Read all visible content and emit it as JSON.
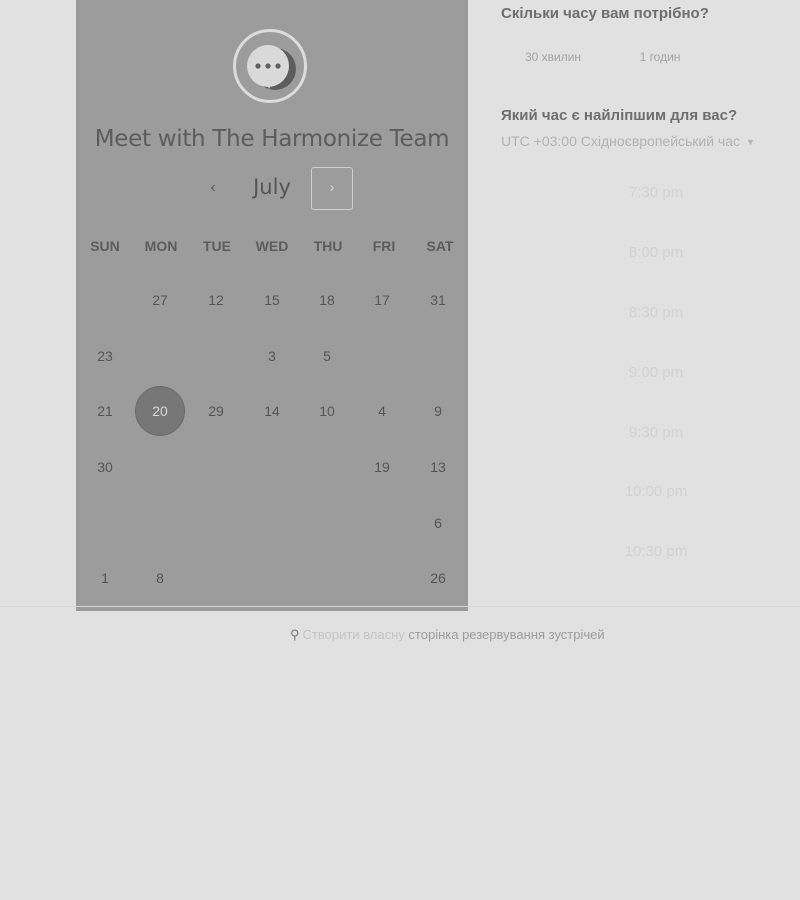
{
  "left_panel": {
    "title": "Meet with The Harmonize Team",
    "month": "July",
    "prev_glyph": "‹",
    "next_glyph": "›",
    "weekdays": [
      "SUN",
      "MON",
      "TUE",
      "WED",
      "THU",
      "FRI",
      "SAT"
    ],
    "days": [
      {
        "label": "27"
      },
      {
        "label": "12"
      },
      {
        "label": "15"
      },
      {
        "label": "18"
      },
      {
        "label": "17"
      },
      {
        "label": "31"
      },
      {
        "label": "23"
      },
      {
        "label": "3"
      },
      {
        "label": "5"
      },
      {
        "label": "21"
      },
      {
        "label": "20",
        "selected": true
      },
      {
        "label": "29"
      },
      {
        "label": "14"
      },
      {
        "label": "10"
      },
      {
        "label": "4"
      },
      {
        "label": "9"
      },
      {
        "label": "30"
      },
      {
        "label": "19"
      },
      {
        "label": "13"
      },
      {
        "label": "6"
      },
      {
        "label": "1"
      },
      {
        "label": "8"
      },
      {
        "label": "26"
      }
    ]
  },
  "right_panel": {
    "duration_question": "Скільки часу вам потрібно?",
    "durations": [
      "30 хвилин",
      "1 годин"
    ],
    "time_question": "Який час є найліпшим для вас?",
    "timezone": "UTC +03:00 Східноєвропейський час",
    "slots": [
      "7:30 pm",
      "8:00 pm",
      "8:30 pm",
      "9:00 pm",
      "9:30 pm",
      "10:00 pm",
      "10:30 pm"
    ]
  },
  "footer": {
    "link_prefix": "Створити власну",
    "link_rest": "сторінка резервування зустрічей",
    "icon": "hubspot-sprocket-icon"
  },
  "colors": {
    "page_bg": "#e1e1e1",
    "calendar_bg": "#9c9c9c",
    "selected_day": "#777777"
  }
}
